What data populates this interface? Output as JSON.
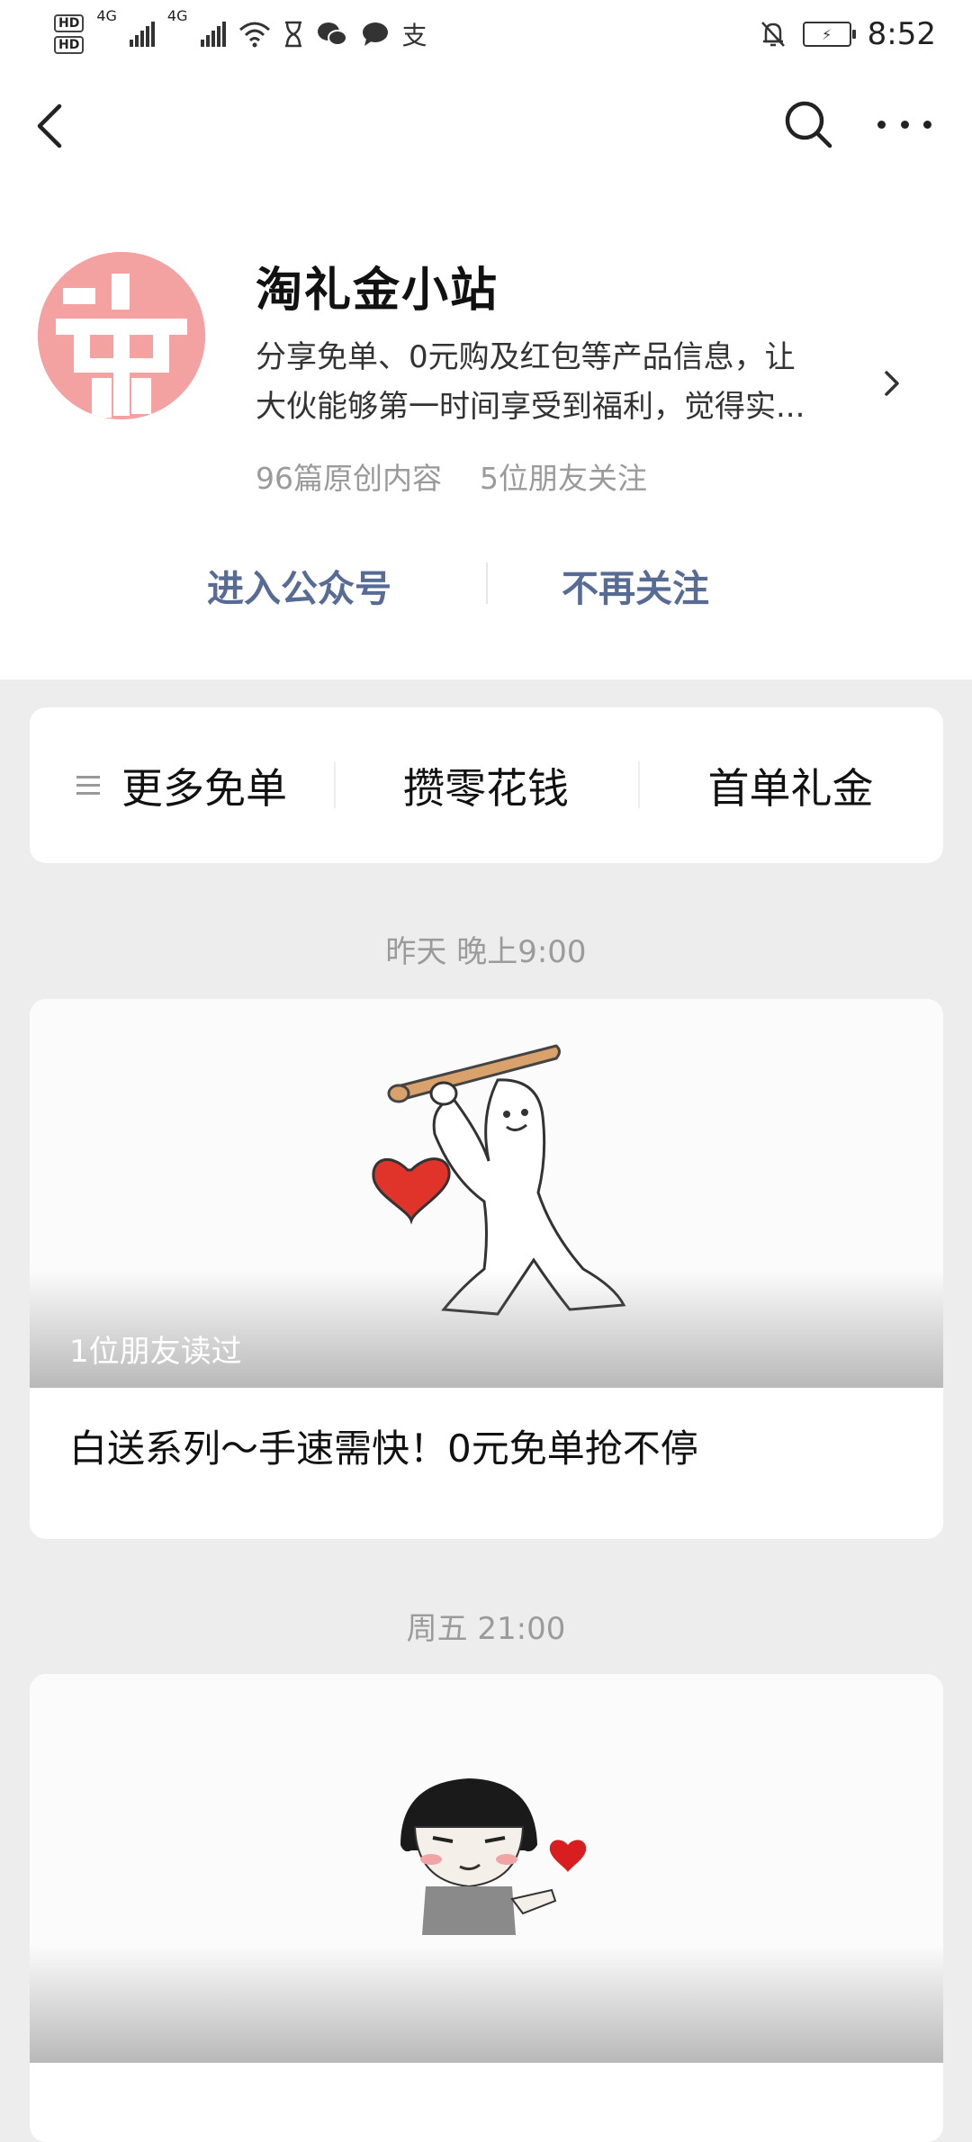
{
  "status_bar": {
    "hd1": "HD",
    "hd2": "HD",
    "net1": "4G",
    "net2": "4G",
    "time": "8:52",
    "icons": [
      "hd-icon",
      "signal-icon",
      "wifi-icon",
      "hourglass-icon",
      "wechat-icon",
      "message-icon",
      "alipay-icon",
      "mute-bell-icon",
      "battery-charging-icon"
    ]
  },
  "nav": {
    "back_icon": "chevron-left-icon",
    "search_icon": "search-icon",
    "more_icon": "more-dots-icon"
  },
  "account": {
    "avatar_char": "免",
    "name": "淘礼金小站",
    "description_line1": "分享免单、0元购及红包等产品信息，让",
    "description_line2": "大伙能够第一时间享受到福利，觉得实...",
    "original_count": "96篇原创内容",
    "friends_following": "5位朋友关注"
  },
  "actions": {
    "enter": "进入公众号",
    "unfollow": "不再关注"
  },
  "menu": {
    "items": [
      {
        "label": "更多免单"
      },
      {
        "label": "攒零花钱"
      },
      {
        "label": "首单礼金"
      }
    ]
  },
  "articles": [
    {
      "timestamp": "昨天 晚上9:00",
      "read_by": "1位朋友读过",
      "title": "白送系列～手速需快！0元免单抢不停"
    },
    {
      "timestamp": "周五 21:00"
    }
  ],
  "colors": {
    "link_blue": "#576b95",
    "avatar_pink": "#f4a1a1",
    "background": "#ededed",
    "heart_red": "#e0342b"
  }
}
